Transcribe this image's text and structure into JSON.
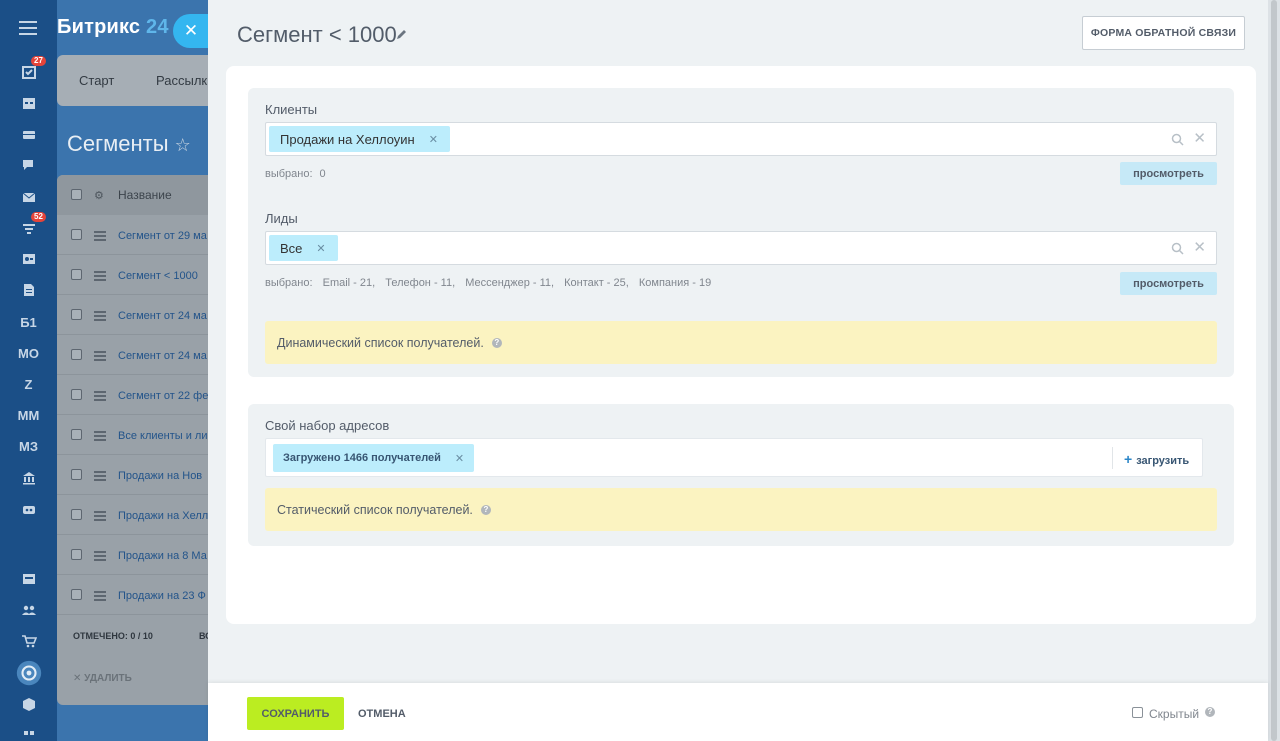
{
  "rail": {
    "badges": {
      "tasks": "27",
      "feed": "52"
    },
    "text_items": [
      "Б1",
      "МО",
      "Z",
      "ММ",
      "МЗ"
    ]
  },
  "background_app": {
    "logo_main": "Битрикс",
    "logo_num": "24",
    "topmenu": [
      "Старт",
      "Рассылк"
    ],
    "page_title": "Сегменты",
    "grid_header": "Название",
    "rows": [
      "Сегмент от 29 ма",
      "Сегмент < 1000",
      "Сегмент от 24 ма",
      "Сегмент от 24 ма",
      "Сегмент от 22 фе",
      "Все клиенты и ли",
      "Продажи на Нов",
      "Продажи на Хелл",
      "Продажи на 8 Ма",
      "Продажи на 23 Ф"
    ],
    "footer_marked": "ОТМЕЧЕНО: 0 / 10",
    "footer_all": "ВС",
    "delete": "УДАЛИТЬ"
  },
  "panel": {
    "title": "Сегмент < 1000",
    "feedback_button": "ФОРМА ОБРАТНОЙ СВЯЗИ",
    "clients": {
      "label": "Клиенты",
      "tag": "Продажи на Хеллоуин",
      "selected_label": "выбрано:",
      "selected_value": "0",
      "view_button": "просмотреть"
    },
    "leads": {
      "label": "Лиды",
      "tag": "Все",
      "selected_label": "выбрано:",
      "counts": [
        "Email - 21,",
        "Телефон - 11,",
        "Мессенджер - 11,",
        "Контакт - 25,",
        "Компания - 19"
      ],
      "view_button": "просмотреть"
    },
    "dynamic_note": "Динамический список получателей.",
    "own_addresses": {
      "label": "Свой набор адресов",
      "tag": "Загружено 1466 получателей",
      "upload_button": "загрузить"
    },
    "static_note": "Статический список получателей."
  },
  "actions": {
    "save": "СОХРАНИТЬ",
    "cancel": "ОТМЕНА",
    "hidden_label": "Скрытый"
  },
  "colors": {
    "save_button": "#bbed21",
    "tag_bg": "#bcedfc",
    "note_bg": "#fbf3c1",
    "close_button": "#34b6f0"
  }
}
